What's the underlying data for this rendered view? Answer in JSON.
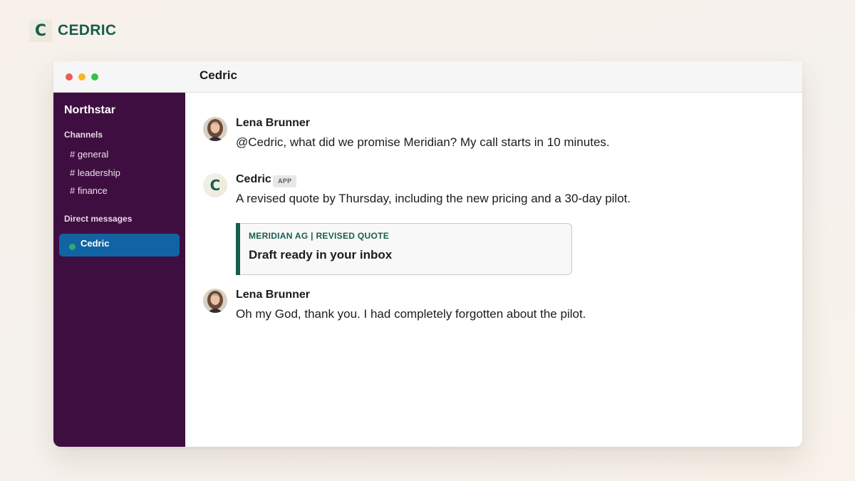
{
  "brand": {
    "logo_letter": "C",
    "name": "CEDRIC",
    "color": "#175e4e"
  },
  "window": {
    "title": "Cedric"
  },
  "sidebar": {
    "workspace": "Northstar",
    "channels_label": "Channels",
    "channels": [
      "# general",
      "# leadership",
      "# finance"
    ],
    "dm_label": "Direct messages",
    "dm_items": [
      {
        "label": "Cedric",
        "active": true,
        "presence": "online"
      }
    ],
    "colors": {
      "background": "#3f0e40",
      "active": "#1164a3",
      "presence": "#2bac76"
    }
  },
  "messages": [
    {
      "sender": "Lena Brunner",
      "avatar": "user-photo",
      "text": "@Cedric, what did we promise Meridian? My call starts in 10 minutes."
    },
    {
      "sender": "Cedric",
      "badge": "APP",
      "avatar": "app-logo",
      "avatar_letter": "C",
      "text": "A revised quote by Thursday, including the new pricing and a 30-day pilot."
    },
    {
      "sender": "Lena Brunner",
      "avatar": "user-photo",
      "text": "Oh my God, thank you. I had completely forgotten about the pilot."
    }
  ],
  "attachment": {
    "kicker": "MERIDIAN AG | REVISED QUOTE",
    "title": "Draft ready in your inbox",
    "accent": "#175e4e"
  },
  "icons": {
    "window_controls": [
      "close-dot",
      "minimize-dot",
      "maximize-dot"
    ]
  }
}
